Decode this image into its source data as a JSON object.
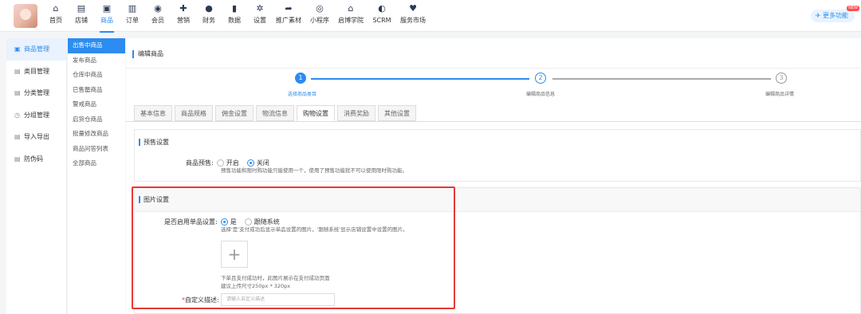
{
  "nav": {
    "items": [
      {
        "icon": "home-icon",
        "glyph": "⌂",
        "label": "首页"
      },
      {
        "icon": "store-icon",
        "glyph": "▤",
        "label": "店铺"
      },
      {
        "icon": "product-icon",
        "glyph": "▣",
        "label": "商品"
      },
      {
        "icon": "order-icon",
        "glyph": "▥",
        "label": "订单"
      },
      {
        "icon": "member-icon",
        "glyph": "◉",
        "label": "会员"
      },
      {
        "icon": "marketing-icon",
        "glyph": "✚",
        "label": "营销"
      },
      {
        "icon": "finance-icon",
        "glyph": "●",
        "label": "财务"
      },
      {
        "icon": "data-icon",
        "glyph": "▮",
        "label": "数据"
      },
      {
        "icon": "settings-icon",
        "glyph": "✲",
        "label": "设置"
      },
      {
        "icon": "promotion-icon",
        "glyph": "➦",
        "label": "推广素材"
      },
      {
        "icon": "miniprogram-icon",
        "glyph": "◎",
        "label": "小程序"
      },
      {
        "icon": "academy-icon",
        "glyph": "⌂",
        "label": "启博学院"
      },
      {
        "icon": "scrm-icon",
        "glyph": "◐",
        "label": "SCRM"
      },
      {
        "icon": "service-market-icon",
        "glyph": "♥",
        "label": "服务市场"
      }
    ],
    "active_index": 2,
    "more": "更多功能",
    "new_badge": "NEW"
  },
  "sidebar1": {
    "items": [
      {
        "icon": "▣",
        "label": "商品管理"
      },
      {
        "icon": "▤",
        "label": "类目管理"
      },
      {
        "icon": "▤",
        "label": "分类管理"
      },
      {
        "icon": "◷",
        "label": "分组管理"
      },
      {
        "icon": "▤",
        "label": "导入导出"
      },
      {
        "icon": "▤",
        "label": "防伪码"
      }
    ]
  },
  "sidebar2": {
    "items": [
      "出售中商品",
      "发布商品",
      "仓库中商品",
      "已售罄商品",
      "警戒商品",
      "启货仓商品",
      "批量修改商品",
      "商品问答列表",
      "全部商品"
    ]
  },
  "main": {
    "page_title": "编辑商品",
    "steps": [
      {
        "num": "1",
        "label": "选择商品类目"
      },
      {
        "num": "2",
        "label": "编辑商品信息"
      },
      {
        "num": "3",
        "label": "编辑商品详情"
      }
    ],
    "tabs": [
      "基本信息",
      "商品规格",
      "佣金设置",
      "物流信息",
      "购物设置",
      "消费奖励",
      "其他设置"
    ],
    "active_tab": 4,
    "presale": {
      "title": "预售设置",
      "field_label": "商品预售:",
      "opt_on": "开启",
      "opt_off": "关闭",
      "hint": "预售功能和限时购功能只能使用一个，使用了预售功能就不可以使用限时购功能。"
    },
    "image": {
      "title": "图片设置",
      "field_label": "是否启用单品设置:",
      "opt_yes": "是",
      "opt_follow": "跟随系统",
      "hint": "选择'是'支付成功后显示单品设置的图片，'跟随系统'显示店铺设置中设置的图片。",
      "upload_glyph": "+",
      "upload_hint1": "下单且支付成功时，此图片展示在支付成功页面",
      "upload_hint2": "建议上传尺寸250px * 320px",
      "required_mark": "*",
      "desc_label": "自定义描述:",
      "desc_placeholder": "请输入自定义描述"
    }
  },
  "colors": {
    "accent": "#2d8cf0",
    "highlight": "#e53935"
  }
}
